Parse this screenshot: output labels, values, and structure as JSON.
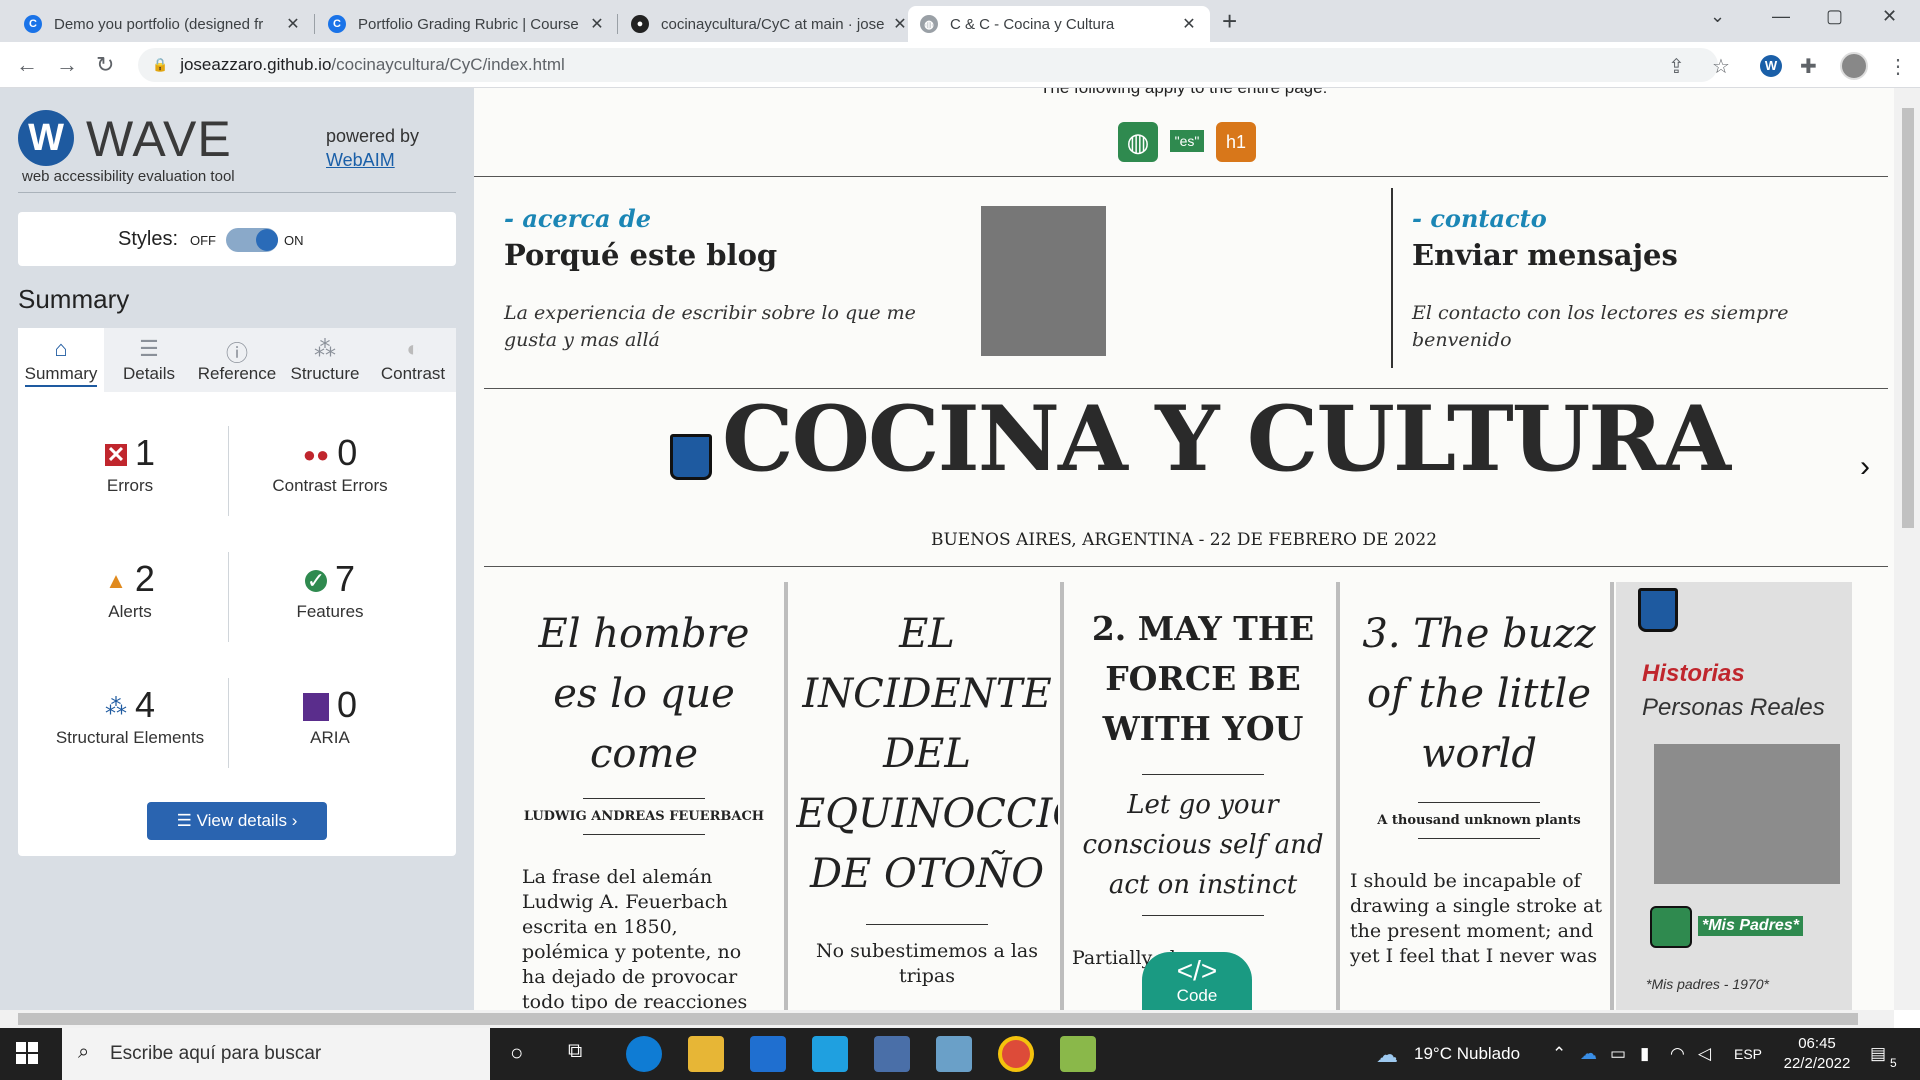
{
  "browser": {
    "tabs": [
      {
        "title": "Demo you portfolio (designed fr",
        "favicon": "chrome-icon"
      },
      {
        "title": "Portfolio Grading Rubric | Course",
        "favicon": "course-icon"
      },
      {
        "title": "cocinaycultura/CyC at main · jose",
        "favicon": "github-icon"
      },
      {
        "title": "C & C - Cocina y Cultura",
        "favicon": "globe-icon"
      }
    ],
    "url_host": "joseazzaro.github.io",
    "url_path": "/cocinaycultura/CyC/index.html"
  },
  "wave": {
    "title": "WAVE",
    "subtitle": "web accessibility evaluation tool",
    "powered_by": "powered by",
    "powered_link": "WebAIM",
    "styles_label": "Styles:",
    "styles_off": "OFF",
    "styles_on": "ON",
    "summary_heading": "Summary",
    "tabs": [
      "Summary",
      "Details",
      "Reference",
      "Structure",
      "Contrast"
    ],
    "stats": {
      "errors": {
        "count": "1",
        "label": "Errors"
      },
      "contrast": {
        "count": "0",
        "label": "Contrast Errors"
      },
      "alerts": {
        "count": "2",
        "label": "Alerts"
      },
      "features": {
        "count": "7",
        "label": "Features"
      },
      "structural": {
        "count": "4",
        "label": "Structural Elements"
      },
      "aria": {
        "count": "0",
        "label": "ARIA"
      }
    },
    "view_details": "View details ›"
  },
  "page": {
    "wave_note": "The following apply to the entire page:",
    "lang_badge": "\"es\"",
    "h1_badge": "h1",
    "about": {
      "kicker": "- acerca de",
      "heading": "Porqué este blog",
      "sub": "La experiencia de escribir sobre lo que me gusta y mas allá"
    },
    "contact": {
      "kicker": "- contacto",
      "heading": "Enviar mensajes",
      "sub": "El contacto con los lectores es siempre benvenido"
    },
    "masthead": "COCINA Y CULTURA",
    "dateline": "BUENOS AIRES, ARGENTINA - 22 DE FEBRERO DE 2022",
    "col1": {
      "title": "El hombre es lo que come",
      "byline": "LUDWIG ANDREAS FEUERBACH",
      "body": "La frase del alemán Ludwig A. Feuerbach escrita en 1850, polémica y potente, no ha dejado de provocar todo tipo de reacciones desde el"
    },
    "col2": {
      "title": "EL INCIDENTE DEL EQUINOCCIO DE OTOÑO",
      "body": "No subestimemos a las tripas"
    },
    "col3": {
      "title": "2. MAY THE FORCE BE WITH YOU",
      "quote": "Let go your conscious self and act on instinct",
      "body": "Partially obeys"
    },
    "col4": {
      "title": "3. The buzz of the little world",
      "byline": "A thousand unknown plants",
      "body": "I should be incapable of drawing a single stroke at the present moment; and yet I feel that I never was"
    },
    "side": {
      "heading": "Historias",
      "subheading": "Personas Reales",
      "alt_text": "*Mis Padres*",
      "caption": "*Mis padres - 1970*"
    },
    "code_glyph": "</>",
    "code_label": "Code"
  },
  "taskbar": {
    "search_placeholder": "Escribe aquí para buscar",
    "weather": "19°C  Nublado",
    "lang": "ESP",
    "time": "06:45",
    "date": "22/2/2022",
    "notifications": "5"
  }
}
